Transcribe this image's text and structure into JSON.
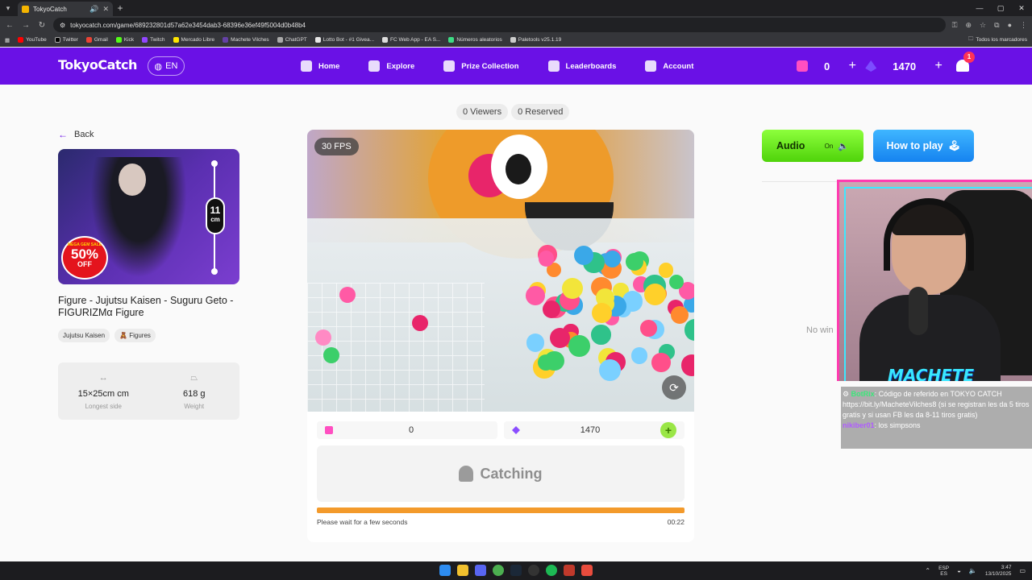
{
  "browser": {
    "tab_title": "TokyoCatch",
    "url": "tokyocatch.com/game/689232801d57a62e3454dab3-68396e36ef49f5004d0b48b4",
    "bookmarks": [
      "YouTube",
      "Twitter",
      "Gmail",
      "Kick",
      "Twitch",
      "Mercado Libre",
      "Machete Vilches",
      "ChatGPT",
      "Lotto Bot - #1 Givea...",
      "FC Web App - EA S...",
      "Números aleatorios",
      "Paletools v25.1.19"
    ],
    "bookmarks_right": "Todos los marcadores"
  },
  "header": {
    "logo": "TokyoCatch",
    "lang": "EN",
    "nav": [
      "Home",
      "Explore",
      "Prize Collection",
      "Leaderboards",
      "Account"
    ],
    "tickets": "0",
    "gems": "1470",
    "notifications": "1"
  },
  "page": {
    "viewers": "0 Viewers",
    "reserved": "0 Reserved",
    "back": "Back"
  },
  "product": {
    "title": "Figure - Jujutsu Kaisen - Suguru Geto - FIGURIZMα Figure",
    "tags": [
      "Jujutsu Kaisen",
      "Figures"
    ],
    "tag_prefix_icon": "figure-emoji",
    "badge_top": "MEGA GEM SALE",
    "badge_pct": "50%",
    "badge_off": "OFF",
    "size_num": "11",
    "size_unit": "cm",
    "dimensions": "15×25cm cm",
    "dimensions_label": "Longest side",
    "weight": "618 g",
    "weight_label": "Weight"
  },
  "video": {
    "fps": "30 FPS"
  },
  "controls": {
    "tickets": "0",
    "gems": "1470",
    "catch_label": "Catching",
    "progress": 1.0,
    "wait_text": "Please wait for a few seconds",
    "timer": "00:22"
  },
  "side": {
    "audio_label": "Audio",
    "audio_state": "On",
    "howto_label": "How to play",
    "no_win": "No win"
  },
  "stream": {
    "name": "MACHETE",
    "chat": [
      {
        "user": "BotRix",
        "text": ": Código de referido en TOKYO CATCH https://bit.ly/MacheteVilches8 (si se registran les da 5 tiros gratis y si usan FB les da 8-11 tiros gratis)"
      },
      {
        "user": "nikiber01",
        "text": ": los simpsons"
      }
    ]
  },
  "taskbar": {
    "lang_top": "ESP",
    "lang_bottom": "ES",
    "time": "3:47",
    "date": "13/10/2025"
  },
  "colors": {
    "brand": "#6a11e6",
    "audio_green": "#4fd30a",
    "howto_blue": "#1583f0",
    "progress_orange": "#f39a2b"
  }
}
